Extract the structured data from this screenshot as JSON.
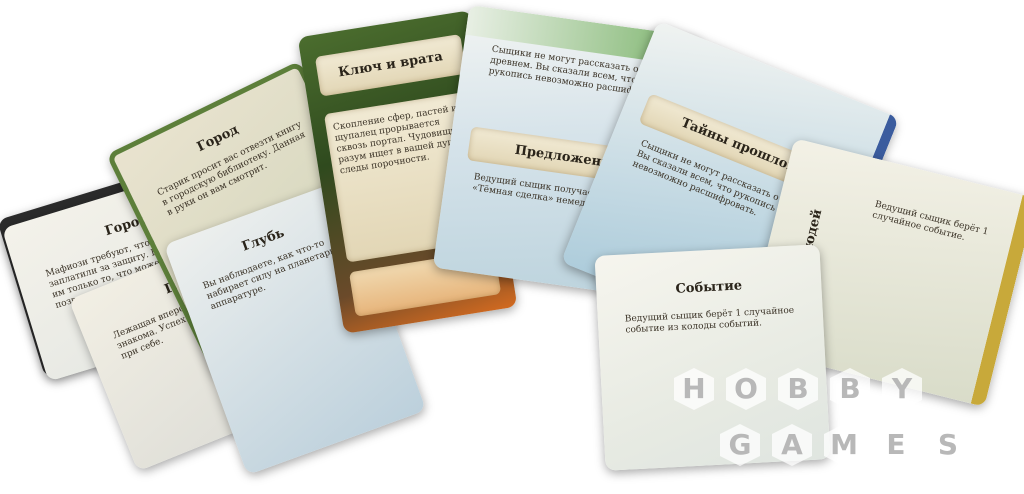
{
  "cards": [
    {
      "title": "Город",
      "text": "Мафиози требуют, чтобы вы заплатили за защиту. Вы предлагаете им только то, что можете себе позволить."
    },
    {
      "title": "Город",
      "text": "Старик просит вас отвезти книгу в городскую библиотеку. Данная в руки он вам смотрит."
    },
    {
      "title": "Глубь",
      "text": "Лежащая впереди местность вам знакома. Успех вы можете держать при себе."
    },
    {
      "title": "Глубь",
      "text": "Вы наблюдаете, как что-то набирает силу на планетарной аппаратуре."
    },
    {
      "title": "Ключ и врата",
      "text": "Скопление сфер, пастей и щупалец прорывается сквозь портал. Чудовищный разум ищет в вашей душе следы порочности."
    },
    {
      "title": "Тайны прошлого",
      "text": "Сыщики не могут рассказать о древнем. Вы сказали всем, что рукопись невозможно расшифровать."
    },
    {
      "title": "Предложение",
      "text": "Ведущий сыщик получает состояние «Тёмная сделка» немедленно."
    },
    {
      "title": "Спасти людей",
      "text": "Ведущий сыщик берёт 1 случайное событие."
    },
    {
      "title": "Событие",
      "text": "Ведущий сыщик берёт 1 случайное событие из колоды событий."
    }
  ],
  "watermark": {
    "line1": [
      "H",
      "O",
      "B",
      "B",
      "Y"
    ],
    "line2": [
      "G",
      "A",
      "M",
      "E",
      "S"
    ],
    "color": "#b8b8b8"
  }
}
